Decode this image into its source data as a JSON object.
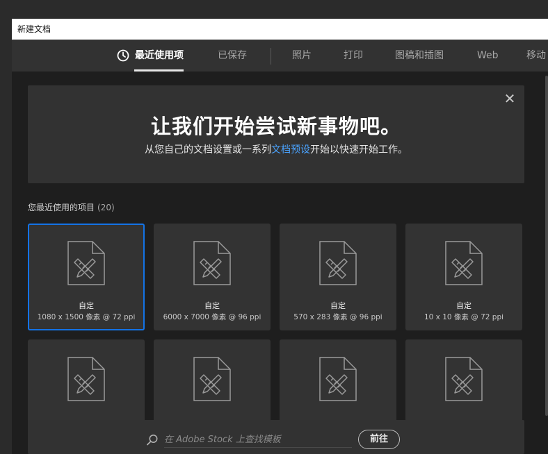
{
  "window": {
    "title": "新建文档"
  },
  "tabs": [
    {
      "label": "最近使用项",
      "active": true
    },
    {
      "label": "已保存"
    },
    {
      "label": "照片"
    },
    {
      "label": "打印"
    },
    {
      "label": "图稿和插图"
    },
    {
      "label": "Web"
    },
    {
      "label": "移动"
    }
  ],
  "hero": {
    "title": "让我们开始尝试新事物吧。",
    "subtitle_before": "从您自己的文档设置或一系列",
    "subtitle_link": "文档预设",
    "subtitle_after": "开始以快速开始工作。",
    "close_icon": "close-icon"
  },
  "recent": {
    "label": "您最近使用的项目",
    "count": "(20)"
  },
  "cards": [
    {
      "name": "自定",
      "meta": "1080 x 1500 像素 @ 72 ppi",
      "selected": true
    },
    {
      "name": "自定",
      "meta": "6000 x 7000 像素 @ 96 ppi"
    },
    {
      "name": "自定",
      "meta": "570 x 283 像素 @ 96 ppi"
    },
    {
      "name": "自定",
      "meta": "10 x 10 像素 @ 72 ppi"
    },
    {
      "name": "",
      "meta": ""
    },
    {
      "name": "",
      "meta": ""
    },
    {
      "name": "",
      "meta": ""
    },
    {
      "name": "",
      "meta": ""
    }
  ],
  "footer": {
    "search_placeholder": "在 Adobe Stock 上查找模板",
    "go_label": "前往"
  },
  "colors": {
    "accent": "#1473e6",
    "link": "#4aa3ff"
  }
}
